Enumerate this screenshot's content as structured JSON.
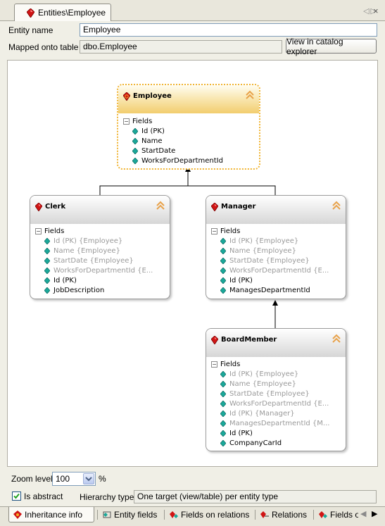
{
  "document_tab": {
    "title": "Entities\\Employee"
  },
  "props": {
    "entity_name_label": "Entity name",
    "entity_name_value": "Employee",
    "mapped_label": "Mapped onto table",
    "mapped_value": "dbo.Employee",
    "catalog_button": "View in catalog explorer"
  },
  "diagram": {
    "employee": {
      "title": "Employee",
      "section": "Fields",
      "fields": [
        "Id (PK)",
        "Name",
        "StartDate",
        "WorksForDepartmentId"
      ]
    },
    "clerk": {
      "title": "Clerk",
      "section": "Fields",
      "inherited": [
        "Id (PK) {Employee}",
        "Name {Employee}",
        "StartDate {Employee}",
        "WorksForDepartmentId {E..."
      ],
      "fields": [
        "Id (PK)",
        "JobDescription"
      ]
    },
    "manager": {
      "title": "Manager",
      "section": "Fields",
      "inherited": [
        "Id (PK) {Employee}",
        "Name {Employee}",
        "StartDate {Employee}",
        "WorksForDepartmentId {E..."
      ],
      "fields": [
        "Id (PK)",
        "ManagesDepartmentId"
      ]
    },
    "boardmember": {
      "title": "BoardMember",
      "section": "Fields",
      "inherited": [
        "Id (PK) {Employee}",
        "Name {Employee}",
        "StartDate {Employee}",
        "WorksForDepartmentId {E...",
        "Id (PK) {Manager}",
        "ManagesDepartmentId {M..."
      ],
      "fields": [
        "Id (PK)",
        "CompanyCarId"
      ]
    }
  },
  "bottom": {
    "zoom_label": "Zoom level",
    "zoom_value": "100",
    "zoom_unit": "%",
    "is_abstract_label": "Is abstract",
    "is_abstract_checked": true,
    "hierarchy_label": "Hierarchy type",
    "hierarchy_value": "One target (view/table) per entity type"
  },
  "tabs": [
    "Inheritance info",
    "Entity fields",
    "Fields on relations",
    "Relations",
    "Fields o"
  ],
  "colors": {
    "selected_border": "#f0b432",
    "entity_icon": "#d01414",
    "field_gem": "#1aa89a",
    "inherited_text": "#9a9a9a"
  }
}
